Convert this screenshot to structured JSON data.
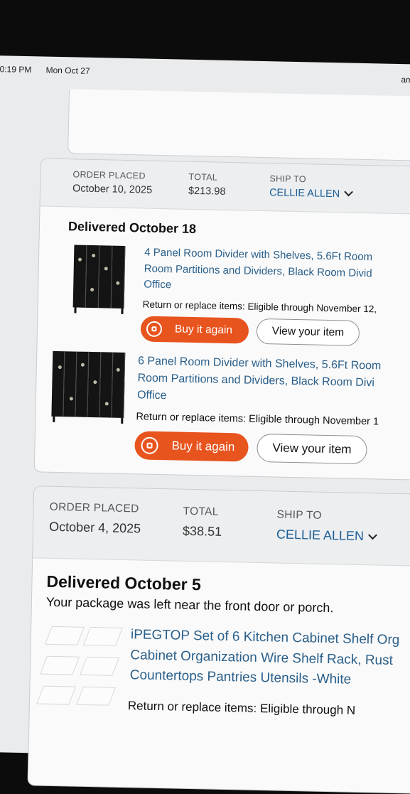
{
  "status_bar": {
    "time": "0:19 PM",
    "date": "Mon Oct 27",
    "site": "am"
  },
  "orders": [
    {
      "header": {
        "order_placed_label": "ORDER PLACED",
        "order_placed_value": "October 10, 2025",
        "total_label": "TOTAL",
        "total_value": "$213.98",
        "ship_to_label": "SHIP TO",
        "ship_to_value": "CELLIE ALLEN"
      },
      "delivery_status": "Delivered October 18",
      "items": [
        {
          "title_lines": [
            "4 Panel Room Divider with Shelves, 5.6Ft Room",
            "Room Partitions and Dividers, Black Room Divid",
            "Office"
          ],
          "return_text": "Return or replace items: Eligible through November 12,",
          "buy_again_label": "Buy it again",
          "view_item_label": "View your item"
        },
        {
          "title_lines": [
            "6 Panel Room Divider with Shelves, 5.6Ft Room",
            "Room Partitions and Dividers, Black Room Divi",
            "Office"
          ],
          "return_text": "Return or replace items: Eligible through November 1",
          "buy_again_label": "Buy it again",
          "view_item_label": "View your item"
        }
      ]
    },
    {
      "header": {
        "order_placed_label": "ORDER PLACED",
        "order_placed_value": "October 4, 2025",
        "total_label": "TOTAL",
        "total_value": "$38.51",
        "ship_to_label": "SHIP TO",
        "ship_to_value": "CELLIE ALLEN"
      },
      "delivery_status": "Delivered October 5",
      "delivery_note": "Your package was left near the front door or porch.",
      "items": [
        {
          "title_lines": [
            "iPEGTOP Set of 6 Kitchen Cabinet Shelf Org",
            "Cabinet Organization Wire Shelf Rack, Rust",
            "Countertops Pantries Utensils -White"
          ],
          "return_text": "Return or replace items: Eligible through N"
        }
      ]
    }
  ],
  "colors": {
    "accent": "#e8541e",
    "link": "#2a5f8a",
    "header_bg": "#eceef0"
  },
  "icons": [
    "chevron-down-icon",
    "buy-again-icon"
  ]
}
